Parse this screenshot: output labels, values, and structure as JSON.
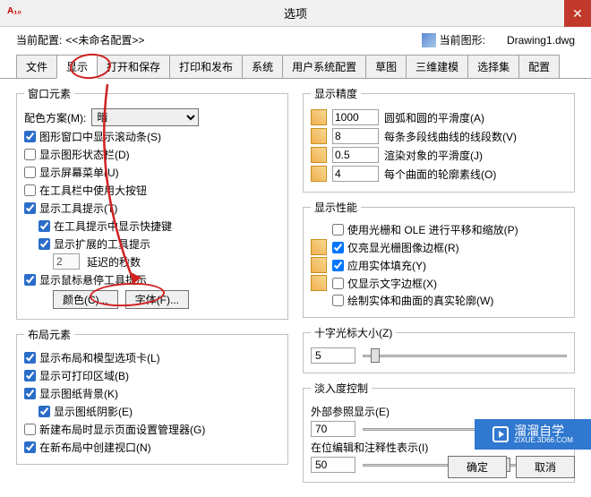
{
  "window": {
    "title": "选项"
  },
  "profile": {
    "current_label": "当前配置:",
    "current_value": "<<未命名配置>>",
    "drawing_label": "当前图形:",
    "drawing_value": "Drawing1.dwg"
  },
  "tabs": [
    "文件",
    "显示",
    "打开和保存",
    "打印和发布",
    "系统",
    "用户系统配置",
    "草图",
    "三维建模",
    "选择集",
    "配置"
  ],
  "active_tab_index": 1,
  "left": {
    "window_elements": {
      "legend": "窗口元素",
      "colorscheme_label": "配色方案(M):",
      "colorscheme_value": "暗",
      "scrollbars": "图形窗口中显示滚动条(S)",
      "statusbar": "显示图形状态栏(D)",
      "screenmenu": "显示屏幕菜单(U)",
      "largebuttons": "在工具栏中使用大按钮",
      "tooltips": "显示工具提示(T)",
      "shortcut_in_tip": "在工具提示中显示快捷键",
      "extended_tip": "显示扩展的工具提示",
      "delay_value": "2",
      "delay_label": "延迟的秒数",
      "rollover_tip": "显示鼠标悬停工具提示",
      "colors_btn": "颜色(C)...",
      "fonts_btn": "字体(F)..."
    },
    "layout_elements": {
      "legend": "布局元素",
      "show_tabs": "显示布局和模型选项卡(L)",
      "printable_area": "显示可打印区域(B)",
      "paper_bg": "显示图纸背景(K)",
      "paper_shadow": "显示图纸阴影(E)",
      "page_setup_mgr": "新建布局时显示页面设置管理器(G)",
      "create_viewport": "在新布局中创建视口(N)"
    }
  },
  "right": {
    "display_accuracy": {
      "legend": "显示精度",
      "arc_smooth": {
        "value": "1000",
        "label": "圆弧和圆的平滑度(A)"
      },
      "polyline_seg": {
        "value": "8",
        "label": "每条多段线曲线的线段数(V)"
      },
      "render_smooth": {
        "value": "0.5",
        "label": "渲染对象的平滑度(J)"
      },
      "surface_contour": {
        "value": "4",
        "label": "每个曲面的轮廓素线(O)"
      }
    },
    "display_perf": {
      "legend": "显示性能",
      "pan_zoom": "使用光栅和 OLE 进行平移和缩放(P)",
      "highlight_raster": "仅亮显光栅图像边框(R)",
      "solid_fill": "应用实体填充(Y)",
      "text_frame": "仅显示文字边框(X)",
      "true_sil": "绘制实体和曲面的真实轮廓(W)"
    },
    "crosshair": {
      "legend": "十字光标大小(Z)",
      "value": "5"
    },
    "fade": {
      "legend": "淡入度控制",
      "xref_label": "外部参照显示(E)",
      "xref_value": "70",
      "inplace_label": "在位编辑和注释性表示(I)",
      "inplace_value": "50"
    }
  },
  "footer": {
    "ok": "确定",
    "cancel": "取消"
  },
  "watermark": {
    "brand": "溜溜自学",
    "url": "ZIXUE.3D66.COM"
  }
}
